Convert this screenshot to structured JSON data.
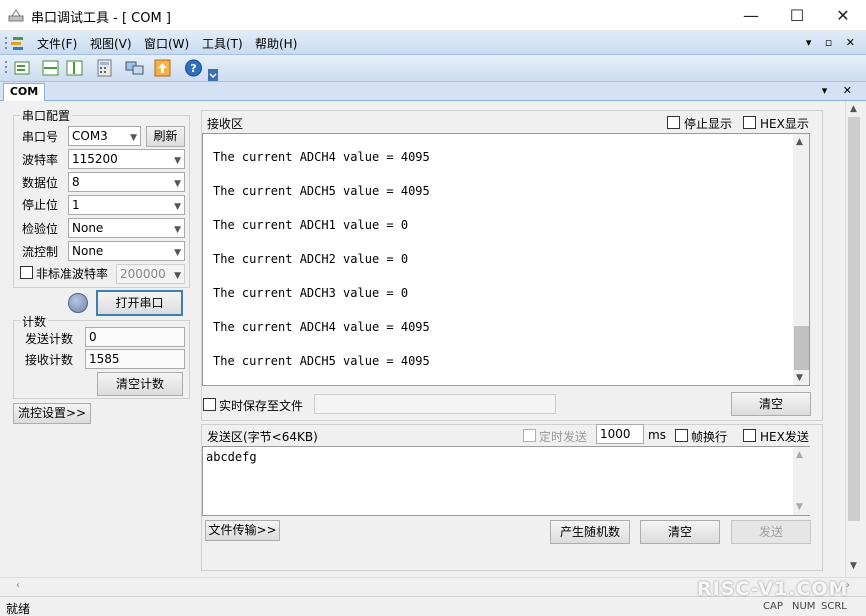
{
  "window": {
    "title": "串口调试工具 - [ COM ]",
    "minimize": "—",
    "maximize": "☐",
    "close": "✕"
  },
  "menu": {
    "items": [
      "文件(F)",
      "视图(V)",
      "窗口(W)",
      "工具(T)",
      "帮助(H)"
    ],
    "mdi_controls": "▾ ▫ ✕"
  },
  "tabs": {
    "active": "COM",
    "controls": "▾ ✕"
  },
  "serial_config": {
    "title": "串口配置",
    "port_label": "串口号",
    "port_value": "COM3",
    "refresh_label": "刷新",
    "baud_label": "波特率",
    "baud_value": "115200",
    "databits_label": "数据位",
    "databits_value": "8",
    "stopbits_label": "停止位",
    "stopbits_value": "1",
    "parity_label": "检验位",
    "parity_value": "None",
    "flow_label": "流控制",
    "flow_value": "None",
    "nonstd_label": "非标准波特率",
    "nonstd_value": "200000",
    "open_label": "打开串口"
  },
  "counter": {
    "title": "计数",
    "send_label": "发送计数",
    "send_value": "0",
    "recv_label": "接收计数",
    "recv_value": "1585",
    "clear_label": "清空计数"
  },
  "flow_settings_label": "流控设置>>",
  "receive": {
    "title": "接收区",
    "stop_display_label": "停止显示",
    "hex_display_label": "HEX显示",
    "lines": [
      "The current ADCH4 value = 4095",
      "The current ADCH5 value = 4095",
      "The current ADCH1 value = 0",
      "The current ADCH2 value = 0",
      "The current ADCH3 value = 0",
      "The current ADCH4 value = 4095",
      "The current ADCH5 value = 4095"
    ],
    "realtime_save_label": "实时保存至文件",
    "clear_label": "清空"
  },
  "send": {
    "title": "发送区(字节<64KB)",
    "timed_send_label": "定时发送",
    "interval_value": "1000",
    "interval_unit": "ms",
    "frame_newline_label": "帧换行",
    "hex_send_label": "HEX发送",
    "content": "abcdefg",
    "file_transfer_label": "文件传输>>",
    "random_label": "产生随机数",
    "clear_label": "清空",
    "send_label": "发送"
  },
  "status": {
    "ready": "就绪",
    "cap": "CAP",
    "num": "NUM",
    "scrl": "SCRL",
    "watermark": "RISC-V1.COM"
  },
  "colors": {
    "accent": "#c9dbf1",
    "open_button_border": "#3c7fb1",
    "indicator": "#7d94b8"
  }
}
